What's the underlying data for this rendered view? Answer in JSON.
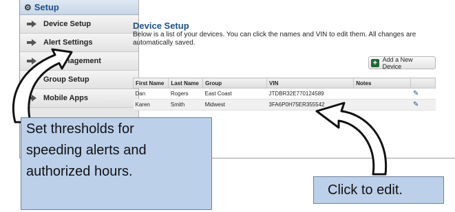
{
  "sidebar": {
    "title": "Setup",
    "items": [
      {
        "label": "Device Setup"
      },
      {
        "label": "Alert Settings"
      },
      {
        "label": "management"
      },
      {
        "label": "Group Setup"
      },
      {
        "label": "Mobile Apps"
      }
    ]
  },
  "main": {
    "title": "Device Setup",
    "description": "Below is a list of your devices. You can click the names and VIN to edit them. All changes are automatically saved.",
    "add_button": "Add a New Device",
    "columns": [
      "First Name",
      "Last Name",
      "Group",
      "VIN",
      "Notes"
    ],
    "rows": [
      [
        "Dan",
        "Rogers",
        "East Coast",
        "JTDBR32E770124589",
        ""
      ],
      [
        "Karen",
        "Smith",
        "Midwest",
        "3FA6P0H75ER355542",
        ""
      ]
    ]
  },
  "callouts": {
    "left": [
      "Set thresholds for",
      "speeding alerts and",
      "authorized hours."
    ],
    "right": "Click to edit."
  }
}
